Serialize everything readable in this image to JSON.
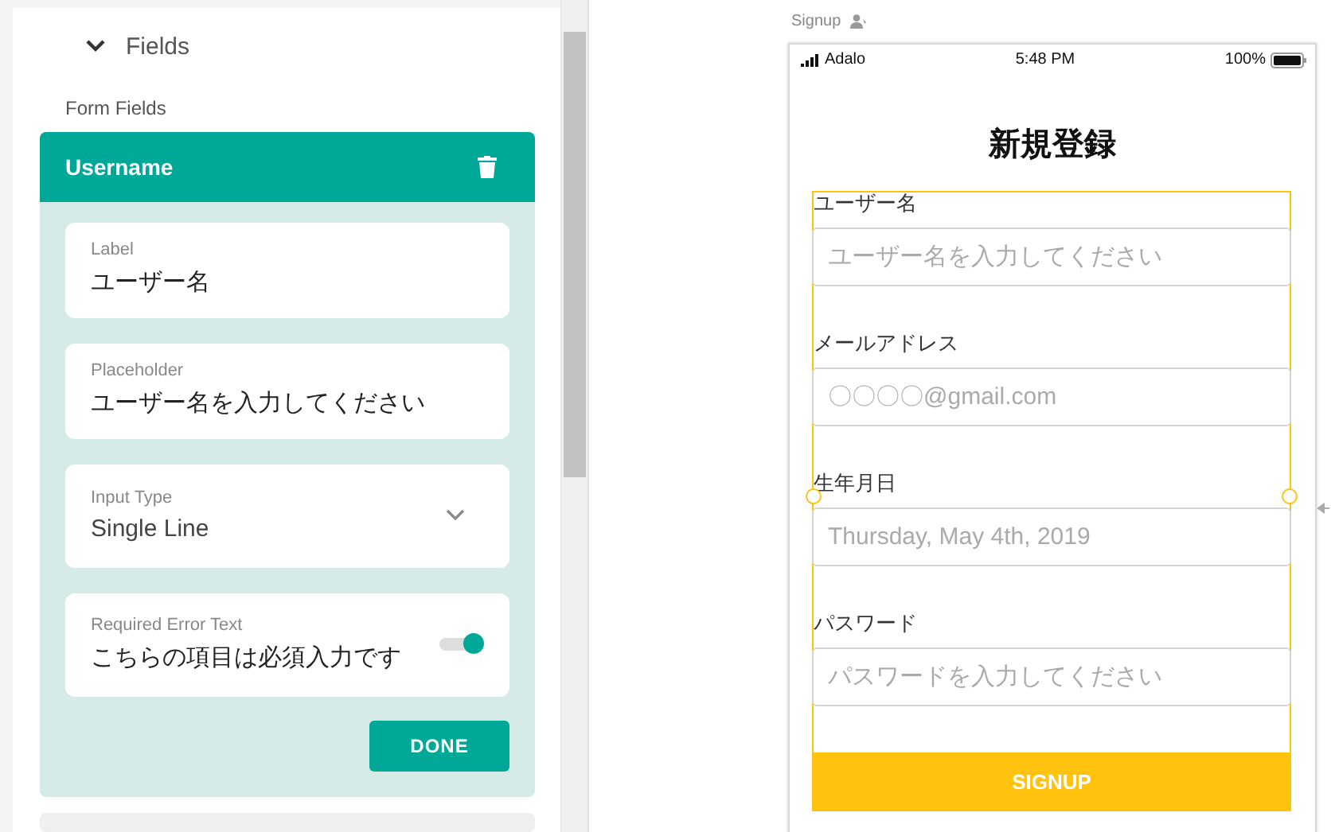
{
  "panel": {
    "section": {
      "title": "Fields",
      "expanded": true
    },
    "subtitle": "Form Fields",
    "field_card": {
      "title": "Username",
      "settings": [
        {
          "kind": "text",
          "label": "Label",
          "value": "ユーザー名"
        },
        {
          "kind": "text",
          "label": "Placeholder",
          "value": "ユーザー名を入力してください"
        },
        {
          "kind": "select",
          "label": "Input Type",
          "value": "Single Line"
        },
        {
          "kind": "toggle",
          "label": "Required Error Text",
          "value": "こちらの項目は必須入力です",
          "on": true
        }
      ],
      "button": "DONE"
    }
  },
  "screen": {
    "name": "Signup",
    "status_bar": {
      "carrier": "Adalo",
      "time": "5:48 PM",
      "battery": "100%"
    },
    "title": "新規登録",
    "form_selected": true,
    "fields": [
      {
        "label": "ユーザー名",
        "placeholder": "ユーザー名を入力してください"
      },
      {
        "label": "メールアドレス",
        "placeholder": "〇〇〇〇@gmail.com"
      },
      {
        "label": "生年月日",
        "placeholder": "Thursday, May 4th, 2019"
      },
      {
        "label": "パスワード",
        "placeholder": "パスワードを入力してください"
      }
    ],
    "button": "SIGNUP"
  }
}
